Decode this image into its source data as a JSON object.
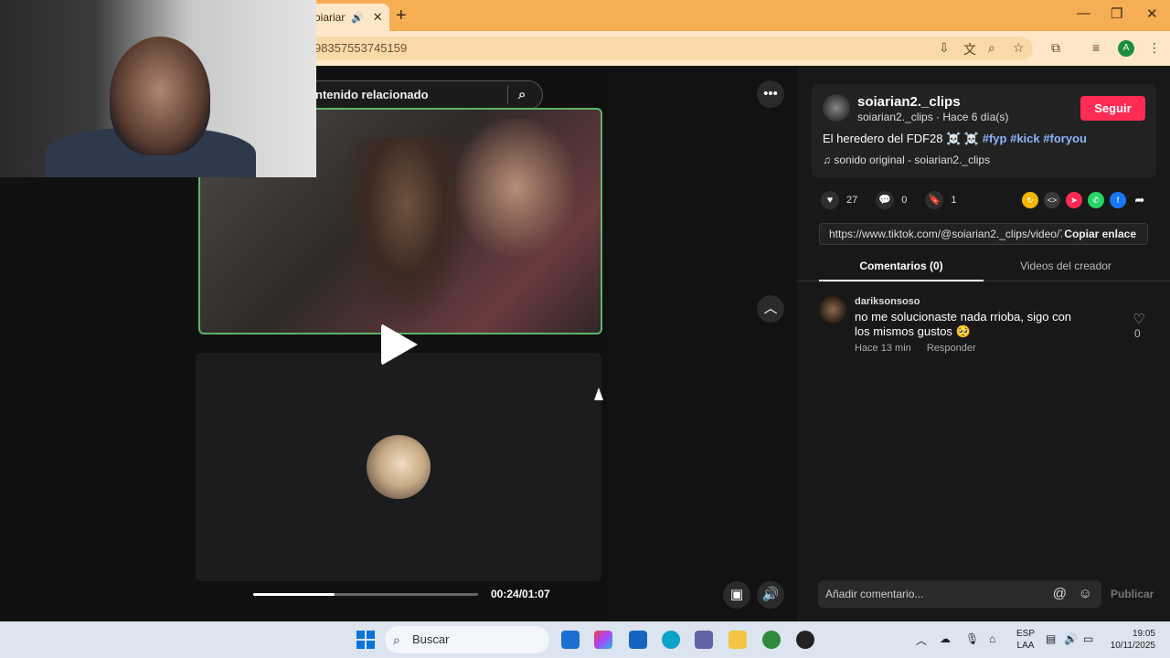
{
  "browser": {
    "tab_title": "oiarian2",
    "tab_audio_icon": "speaker-icon",
    "tab_close": "✕",
    "new_tab": "+",
    "address": "98357553745159",
    "window_controls": [
      "—",
      "❐",
      "✕"
    ],
    "profile_initial": "A"
  },
  "video": {
    "search_placeholder": "ntenido relacionado",
    "time": "00:24/01:07",
    "progress": 0.36
  },
  "panel": {
    "username": "soiarian2._clips",
    "meta": "soiarian2._clips · Hace 6 día(s)",
    "follow_label": "Seguir",
    "description": "El heredero del FDF28 ☠️ ☠️",
    "hashtags": [
      "#fyp",
      "#kick",
      "#foryou"
    ],
    "sound": "sonido original - soiarian2._clips",
    "likes": "27",
    "comments": "0",
    "saves": "1",
    "link_url": "https://www.tiktok.com/@soiarian2._clips/video/75...",
    "copy_label": "Copiar enlace",
    "tab_comments": "Comentarios (0)",
    "tab_creator": "Videos del creador"
  },
  "comment": {
    "author": "dariksonsoso",
    "text": "no me solucionaste nada rrioba, sigo con los mismos gustos 🥺",
    "time": "Hace 13 min",
    "reply": "Responder",
    "likes": "0"
  },
  "composer": {
    "placeholder": "Añadir comentario...",
    "publish_label": "Publicar"
  },
  "taskbar": {
    "search_label": "Buscar",
    "lang_top": "ESP",
    "lang_bottom": "LAA",
    "time": "19:05",
    "date": "10/11/2025"
  },
  "colors": {
    "chrome_tabbar": "#f6ae55",
    "follow_button": "#fe2c55",
    "hashtag": "#8ab4f8",
    "frame_border": "#5db36a"
  }
}
